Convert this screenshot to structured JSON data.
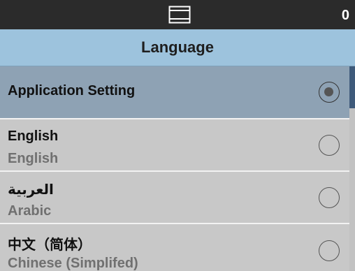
{
  "status": {
    "count": "0",
    "icon": "layout-icon"
  },
  "header": {
    "title": "Language"
  },
  "languages": [
    {
      "primary": "Application Setting",
      "secondary": "",
      "selected": true
    },
    {
      "primary": "English",
      "secondary": "English",
      "selected": false
    },
    {
      "primary": "العربية",
      "secondary": "Arabic",
      "selected": false
    },
    {
      "primary": "中文（简体）",
      "secondary": "Chinese (Simplifed)",
      "selected": false
    }
  ]
}
